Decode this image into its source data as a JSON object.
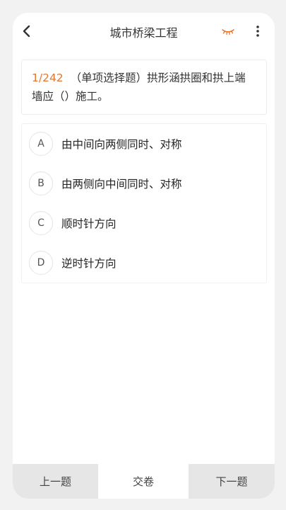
{
  "header": {
    "title": "城市桥梁工程",
    "back_icon": "chevron-left-icon",
    "eye_icon": "closed-eye-icon",
    "more_icon": "more-vertical-icon",
    "accent_color": "#e8752a"
  },
  "question": {
    "number": "1/242",
    "text": "（单项选择题）拱形涵拱圈和拱上端墙应（）施工。"
  },
  "options": [
    {
      "letter": "A",
      "text": "由中间向两侧同时、对称"
    },
    {
      "letter": "B",
      "text": "由两侧向中间同时、对称"
    },
    {
      "letter": "C",
      "text": "顺时针方向"
    },
    {
      "letter": "D",
      "text": "逆时针方向"
    }
  ],
  "footer": {
    "prev_label": "上一题",
    "submit_label": "交卷",
    "next_label": "下一题"
  }
}
